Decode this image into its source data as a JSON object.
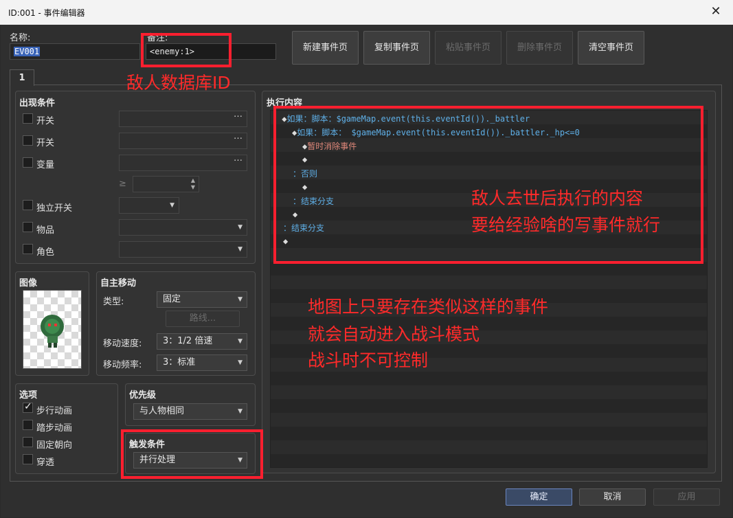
{
  "window": {
    "title": "ID:001 - 事件编辑器",
    "close_glyph": "✕"
  },
  "name": {
    "label": "名称:",
    "value": "EV001"
  },
  "note": {
    "label": "备注:",
    "value": "<enemy:1>"
  },
  "page_buttons": [
    "新建事件页",
    "复制事件页",
    "粘贴事件页",
    "删除事件页",
    "清空事件页"
  ],
  "tab": "1",
  "conditions": {
    "title": "出现条件",
    "items": [
      "开关",
      "开关",
      "变量",
      "独立开关",
      "物品",
      "角色"
    ],
    "gte_symbol": "≥",
    "dots": "…"
  },
  "image": {
    "title": "图像"
  },
  "autonomous": {
    "title": "自主移动",
    "type_label": "类型:",
    "type_value": "固定",
    "route_button": "路线...",
    "speed_label": "移动速度:",
    "speed_value": "3：1/2 倍速",
    "freq_label": "移动频率:",
    "freq_value": "3：标准"
  },
  "options": {
    "title": "选项",
    "items": [
      {
        "label": "步行动画",
        "checked": true
      },
      {
        "label": "踏步动画",
        "checked": false
      },
      {
        "label": "固定朝向",
        "checked": false
      },
      {
        "label": "穿透",
        "checked": false
      }
    ]
  },
  "priority": {
    "title": "优先级",
    "value": "与人物相同"
  },
  "trigger": {
    "title": "触发条件",
    "value": "并行处理"
  },
  "contents": {
    "title": "执行内容",
    "lines": [
      {
        "prefix": ":",
        "marker": "◆",
        "text": "如果：脚本：$gameMap.event(this.eventId())._battler",
        "color": "cyan"
      },
      {
        "prefix": "",
        "marker": "◆",
        "text": "如果：脚本： $gameMap.event(this.eventId())._battler._hp<=0",
        "color": "cyan"
      },
      {
        "prefix": "",
        "marker": "◆",
        "text": "暂时消除事件",
        "color": "pink"
      },
      {
        "prefix": "",
        "marker": "◆",
        "text": "",
        "color": "cyan"
      },
      {
        "prefix": "",
        "marker": "",
        "text": "：否则",
        "color": "cyan"
      },
      {
        "prefix": "",
        "marker": "◆",
        "text": "",
        "color": "cyan"
      },
      {
        "prefix": "",
        "marker": "",
        "text": "：结束分支",
        "color": "cyan"
      },
      {
        "prefix": "",
        "marker": "◆",
        "text": "",
        "color": "cyan"
      },
      {
        "prefix": "",
        "marker": "",
        "text": "：结束分支",
        "color": "cyan"
      },
      {
        "prefix": "",
        "marker": "◆",
        "text": "",
        "color": "cyan"
      }
    ]
  },
  "annotations": {
    "enemy_db": "敌人数据库ID",
    "after_death": [
      "敌人去世后执行的内容",
      "要给经验啥的写事件就行"
    ],
    "auto_battle": [
      "地图上只要存在类似这样的事件",
      "就会自动进入战斗模式",
      "战斗时不可控制"
    ]
  },
  "footer": {
    "ok": "确定",
    "cancel": "取消",
    "apply": "应用"
  },
  "colors": {
    "annotation_red": "#ff1f2f",
    "command_cyan": "#5fb0e8",
    "command_pink": "#e0887a"
  }
}
